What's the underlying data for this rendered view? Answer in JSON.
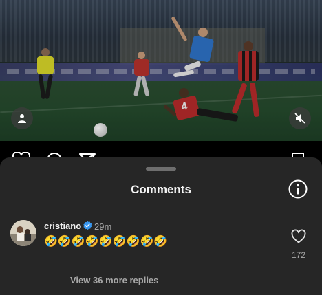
{
  "video": {
    "user_icon": "person-icon",
    "mute_icon": "speaker-muted-icon",
    "player_number": "4"
  },
  "actions": {
    "icons": [
      "heart-icon",
      "comment-icon",
      "share-icon",
      "bookmark-icon"
    ]
  },
  "comments_sheet": {
    "title": "Comments",
    "info_icon": "info-icon",
    "comment": {
      "username": "cristiano",
      "verified": true,
      "time": "29m",
      "text": "🤣🤣🤣🤣🤣🤣🤣🤣🤣",
      "like_count": "172",
      "view_replies": "View 36 more replies"
    }
  },
  "colors": {
    "sheet_bg": "#262626",
    "verified_blue": "#3897f0",
    "secondary_text": "#a8a8a8"
  }
}
